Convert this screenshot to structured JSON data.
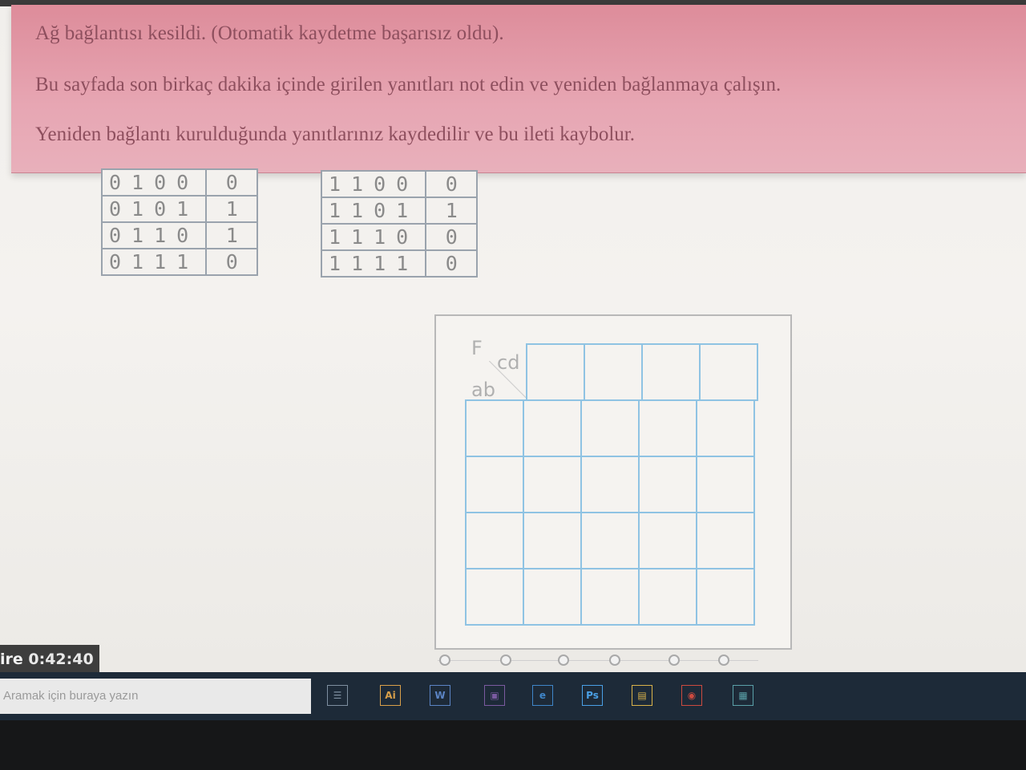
{
  "alert": {
    "line1": "Ağ bağlantısı kesildi. (Otomatik kaydetme başarısız oldu).",
    "line2": "Bu sayfada son birkaç dakika içinde girilen yanıtları not edin ve yeniden bağlanmaya çalışın.",
    "line3": "Yeniden bağlantı kurulduğunda yanıtlarınız kaydedilir ve bu ileti kaybolur."
  },
  "truth_table_left": {
    "rows": [
      {
        "inputs": "0100",
        "output": "0"
      },
      {
        "inputs": "0101",
        "output": "1"
      },
      {
        "inputs": "0110",
        "output": "1"
      },
      {
        "inputs": "0111",
        "output": "0"
      }
    ]
  },
  "truth_table_right": {
    "rows": [
      {
        "inputs": "1100",
        "output": "0"
      },
      {
        "inputs": "1101",
        "output": "1"
      },
      {
        "inputs": "1110",
        "output": "0"
      },
      {
        "inputs": "1111",
        "output": "0"
      }
    ]
  },
  "kmap": {
    "func_label": "F",
    "col_var_label": "cd",
    "row_var_label": "ab"
  },
  "timer": {
    "prefix": "ire ",
    "value": "0:42:40"
  },
  "taskbar": {
    "search_placeholder": "Aramak için buraya yazın",
    "icons": [
      {
        "name": "task-view-icon",
        "glyph": "☰",
        "color": "#7e8fa0"
      },
      {
        "name": "illustrator-icon",
        "glyph": "Ai",
        "color": "#d9a04a"
      },
      {
        "name": "word-icon",
        "glyph": "W",
        "color": "#5b84c4"
      },
      {
        "name": "app-icon",
        "glyph": "▣",
        "color": "#7a5aa0"
      },
      {
        "name": "edge-icon",
        "glyph": "e",
        "color": "#3f86c9"
      },
      {
        "name": "photoshop-icon",
        "glyph": "Ps",
        "color": "#4aa0e6"
      },
      {
        "name": "file-explorer-icon",
        "glyph": "▤",
        "color": "#d9b24a"
      },
      {
        "name": "chrome-icon",
        "glyph": "◉",
        "color": "#cc4a3f"
      },
      {
        "name": "app-icon-2",
        "glyph": "▦",
        "color": "#5aa0a8"
      }
    ]
  }
}
